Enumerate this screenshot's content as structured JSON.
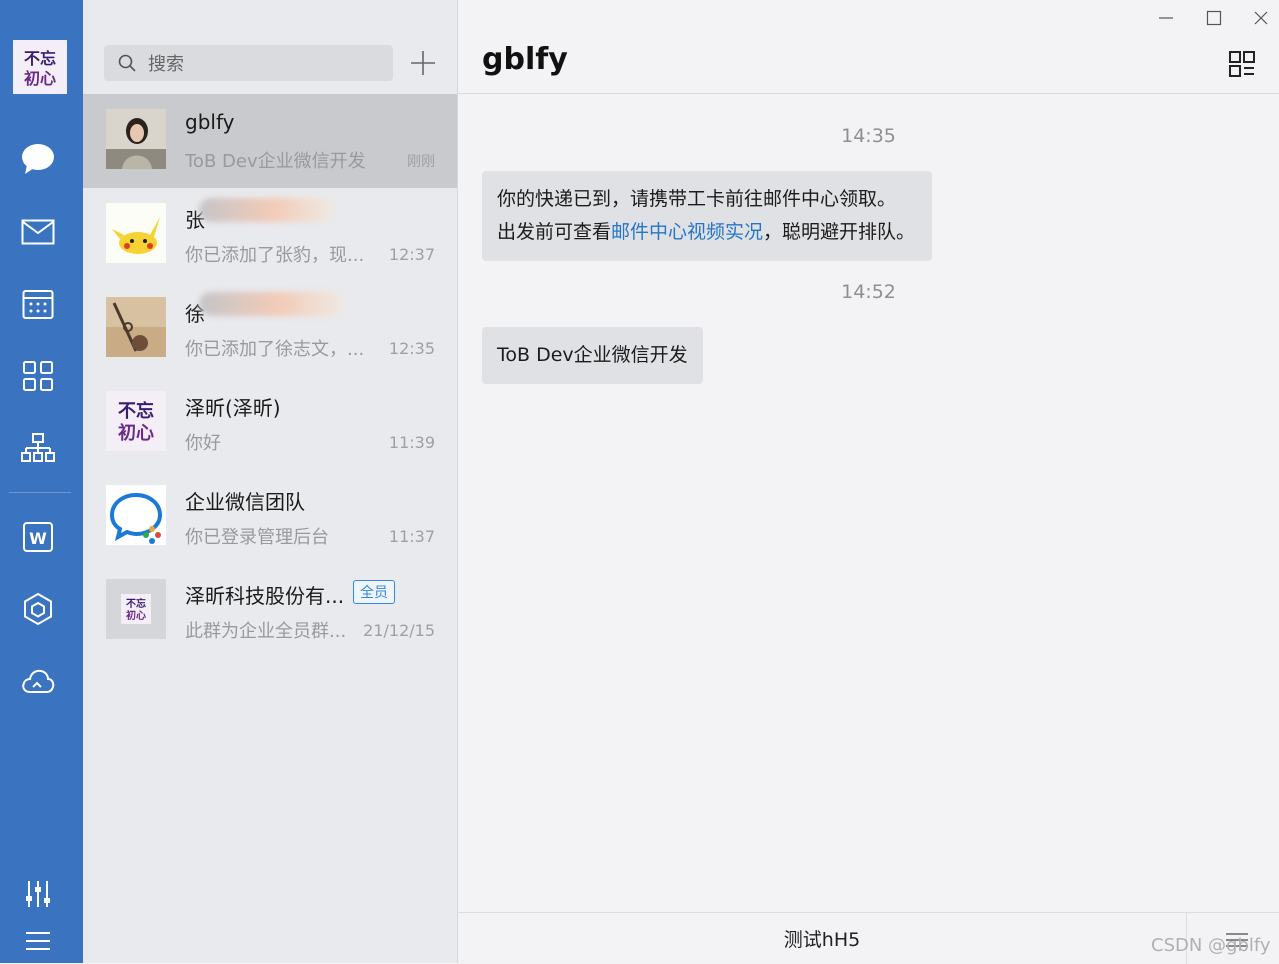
{
  "self": {
    "avatar_text": "不忘初心"
  },
  "nav": {
    "items": [
      {
        "icon": "chat-bubble-icon"
      },
      {
        "icon": "mail-icon"
      },
      {
        "icon": "calendar-icon"
      },
      {
        "icon": "apps-grid-icon"
      },
      {
        "icon": "org-chart-icon"
      },
      {
        "icon": "w-doc-icon"
      },
      {
        "icon": "cube-icon"
      },
      {
        "icon": "cloud-icon"
      }
    ],
    "bottom": [
      {
        "icon": "sliders-icon"
      },
      {
        "icon": "hamburger-menu-icon"
      }
    ]
  },
  "search": {
    "placeholder": "搜索"
  },
  "conversations": [
    {
      "name": "gblfy",
      "preview": "ToB Dev企业微信开发",
      "time": "刚刚",
      "active": true
    },
    {
      "name": "张",
      "preview": "你已添加了张豹，现...",
      "time": "12:37"
    },
    {
      "name": "徐",
      "preview": "你已添加了徐志文，...",
      "time": "12:35"
    },
    {
      "name": "泽昕(泽昕)",
      "preview": "你好",
      "time": "11:39"
    },
    {
      "name": "企业微信团队",
      "preview": "你已登录管理后台",
      "time": "11:37"
    },
    {
      "name": "泽昕科技股份有...",
      "preview": "此群为企业全员群...",
      "time": "21/12/15",
      "tag": "全员"
    }
  ],
  "chat": {
    "title": "gblfy",
    "messages": [
      {
        "timestamp": "14:35",
        "line1": "你的快递已到，请携带工卡前往邮件中心领取。",
        "line2_pre": "出发前可查看",
        "line2_link": "邮件中心视频实况",
        "line2_post": "，聪明避开排队。"
      },
      {
        "timestamp": "14:52",
        "text": "ToB Dev企业微信开发"
      }
    ],
    "bottom_menu": "测试hH5",
    "watermark": "CSDN @gblfy"
  }
}
